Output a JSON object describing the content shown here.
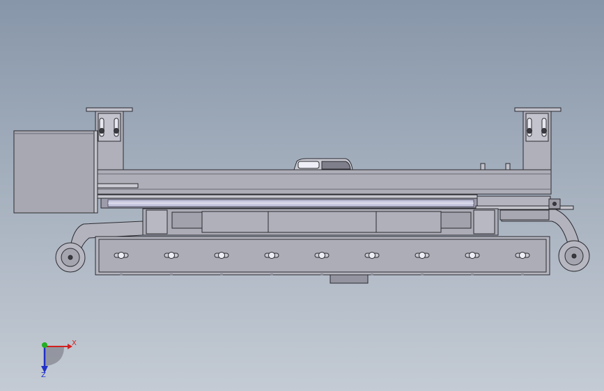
{
  "viewport": {
    "background_top": "#8796a9",
    "background_bottom": "#c4cbd4"
  },
  "model": {
    "part_fill": "#adadb7",
    "part_fill_dark": "#8e8e9a",
    "part_fill_light": "#c9c9d2",
    "edge_color": "#2a2a30",
    "highlight_color": "#eeeef6",
    "bolt_count": 9
  },
  "triad": {
    "x_label": "X",
    "z_label": "Z",
    "x_color": "#d22020",
    "y_color": "#22b022",
    "z_color": "#2030c8"
  }
}
